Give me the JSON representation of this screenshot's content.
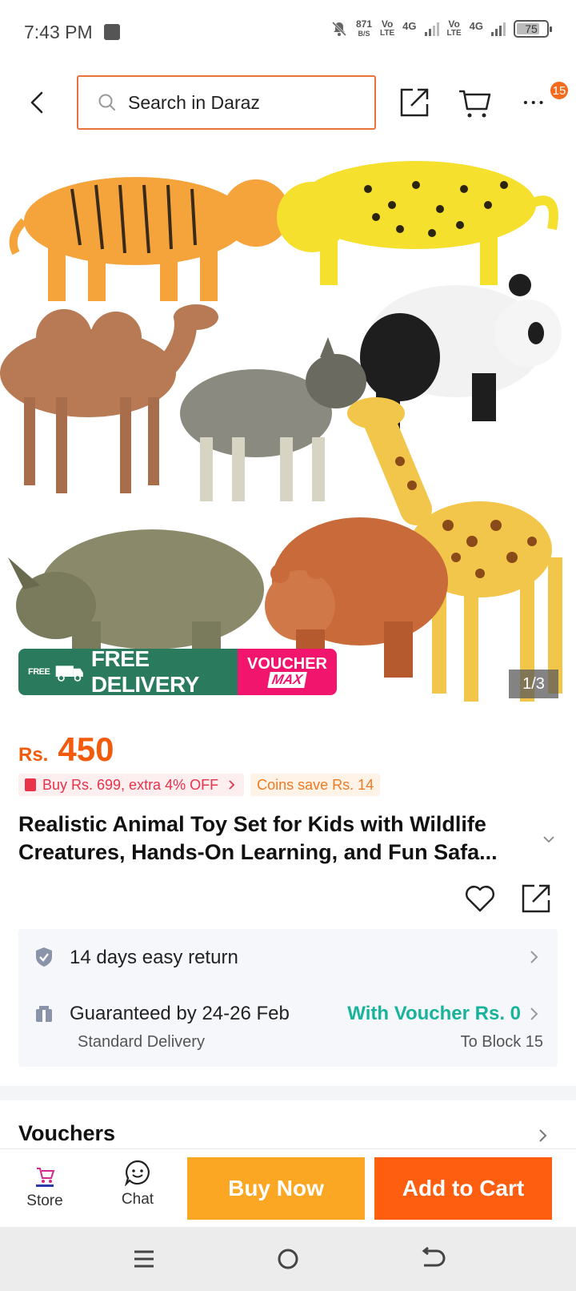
{
  "status_bar": {
    "time": "7:43 PM",
    "net_speed_top": "871",
    "net_speed_bottom": "B/S",
    "sim1_top": "Vo",
    "sim1_bottom": "LTE",
    "sim1_gen": "4G",
    "sim2_top": "Vo",
    "sim2_bottom": "LTE",
    "sim2_gen": "4G",
    "battery": "75"
  },
  "header": {
    "search_placeholder": "Search in Daraz",
    "more_badge": "15"
  },
  "product_image": {
    "free_tag": "FREE",
    "free_delivery": "FREE DELIVERY",
    "voucher_line1": "VOUCHER",
    "voucher_line2": "MAX",
    "counter": "1/3"
  },
  "price": {
    "currency": "Rs.",
    "amount": "450"
  },
  "promos": {
    "bundle": "Buy Rs. 699, extra 4% OFF",
    "coins": "Coins save Rs. 14"
  },
  "product": {
    "title": "Realistic Animal Toy Set for Kids with Wildlife Creatures, Hands-On Learning, and Fun Safa..."
  },
  "info": {
    "return": "14 days easy return",
    "delivery": "Guaranteed by 24-26 Feb",
    "voucher": "With Voucher Rs. 0",
    "delivery_type": "Standard Delivery",
    "location": "To Block 15"
  },
  "vouchers": {
    "title": "Vouchers"
  },
  "action_bar": {
    "store_label": "Store",
    "chat_label": "Chat",
    "buy_now": "Buy Now",
    "add_to_cart": "Add to Cart"
  },
  "colors": {
    "accent_orange": "#f25a0c",
    "buy_now": "#fba724",
    "add_to_cart": "#fd5e10",
    "voucher_green": "#17b39a",
    "free_delivery_green": "#2a7a5e",
    "voucher_pink": "#f2156e"
  }
}
